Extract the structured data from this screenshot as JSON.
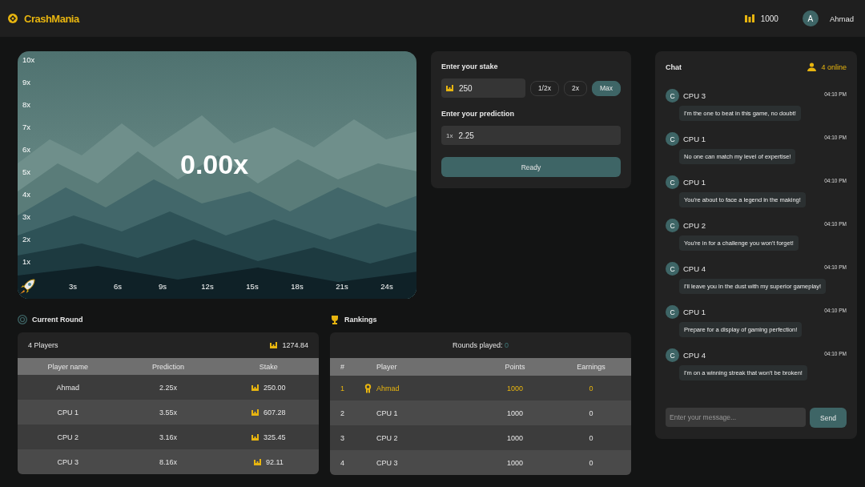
{
  "header": {
    "logo": "CrashMania",
    "balance": "1000",
    "user": {
      "initial": "A",
      "name": "Ahmad"
    }
  },
  "game": {
    "multiplier": "0.00x",
    "y_labels": [
      "10x",
      "9x",
      "8x",
      "7x",
      "6x",
      "5x",
      "4x",
      "3x",
      "2x",
      "1x"
    ],
    "x_labels": [
      "3s",
      "6s",
      "9s",
      "12s",
      "15s",
      "18s",
      "21s",
      "24s"
    ]
  },
  "bet": {
    "stake_label": "Enter your stake",
    "stake_value": "250",
    "stake_buttons": [
      {
        "label": "1/2x",
        "selected": false
      },
      {
        "label": "2x",
        "selected": false
      },
      {
        "label": "Max",
        "selected": true
      }
    ],
    "prediction_label": "Enter your prediction",
    "prediction_prefix": "1x",
    "prediction_value": "2.25",
    "ready": "Ready"
  },
  "current_round": {
    "title": "Current Round",
    "players": "4 Players",
    "total": "1274.84",
    "columns": [
      "Player name",
      "Prediction",
      "Stake"
    ],
    "rows": [
      {
        "name": "Ahmad",
        "prediction": "2.25x",
        "stake": "250.00"
      },
      {
        "name": "CPU 1",
        "prediction": "3.55x",
        "stake": "607.28"
      },
      {
        "name": "CPU 2",
        "prediction": "3.16x",
        "stake": "325.45"
      },
      {
        "name": "CPU 3",
        "prediction": "8.16x",
        "stake": "92.11"
      }
    ]
  },
  "rankings": {
    "title": "Rankings",
    "rounds_label": "Rounds played:",
    "rounds_value": "0",
    "columns": [
      "#",
      "Player",
      "Points",
      "Earnings"
    ],
    "rows": [
      {
        "rank": "1",
        "player": "Ahmad",
        "points": "1000",
        "earnings": "0",
        "highlighted": true
      },
      {
        "rank": "2",
        "player": "CPU 1",
        "points": "1000",
        "earnings": "0",
        "highlighted": false
      },
      {
        "rank": "3",
        "player": "CPU 2",
        "points": "1000",
        "earnings": "0",
        "highlighted": false
      },
      {
        "rank": "4",
        "player": "CPU 3",
        "points": "1000",
        "earnings": "0",
        "highlighted": false
      }
    ]
  },
  "chat": {
    "title": "Chat",
    "online": "4 online",
    "messages": [
      {
        "initial": "C",
        "name": "CPU 3",
        "time": "04:10 PM",
        "text": "I'm the one to beat in this game, no doubt!"
      },
      {
        "initial": "C",
        "name": "CPU 1",
        "time": "04:10 PM",
        "text": "No one can match my level of expertise!"
      },
      {
        "initial": "C",
        "name": "CPU 1",
        "time": "04:10 PM",
        "text": "You're about to face a legend in the making!"
      },
      {
        "initial": "C",
        "name": "CPU 2",
        "time": "04:10 PM",
        "text": "You're in for a challenge you won't forget!"
      },
      {
        "initial": "C",
        "name": "CPU 4",
        "time": "04:10 PM",
        "text": "I'll leave you in the dust with my superior gameplay!"
      },
      {
        "initial": "C",
        "name": "CPU 1",
        "time": "04:10 PM",
        "text": "Prepare for a display of gaming perfection!"
      },
      {
        "initial": "C",
        "name": "CPU 4",
        "time": "04:10 PM",
        "text": "I'm on a winning streak that won't be broken!"
      }
    ],
    "placeholder": "Enter your message...",
    "send": "Send"
  }
}
